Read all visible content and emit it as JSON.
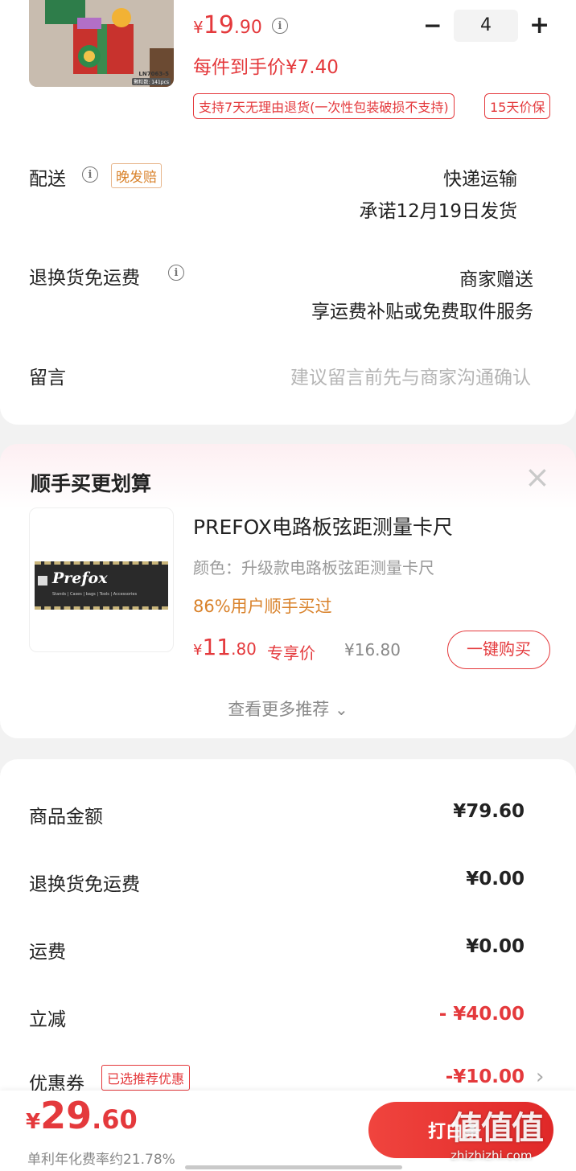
{
  "product": {
    "image_sku": "LN7063-5",
    "image_sub": "颗粒数: 141pcs",
    "price_symbol": "¥",
    "price_int": "19",
    "price_dec": ".90",
    "info_icon": "i",
    "minus": "−",
    "quantity": "4",
    "plus": "+",
    "unit_price_text": "每件到手价¥7.40",
    "return_tag": "支持7天无理由退货(一次性包装破损不支持)",
    "price_protect_tag": "15天价保"
  },
  "delivery": {
    "label": "配送",
    "late_tag": "晚发赔",
    "method": "快递运输",
    "ship_promise": "承诺12月19日发货"
  },
  "return_shipping": {
    "label": "退换货免运费",
    "value1": "商家赠送",
    "value2": "享运费补贴或免费取件服务"
  },
  "message": {
    "label": "留言",
    "placeholder": "建议留言前先与商家沟通确认"
  },
  "recommend": {
    "title": "顺手买更划算",
    "close": "×",
    "logo_text": "Prefox",
    "logo_sub": "Stands | Cases | bags | Tools | Accessories",
    "item_title": "PREFOX电路板弦距测量卡尺",
    "item_color": "颜色：升级款电路板弦距测量卡尺",
    "item_social": "86%用户顺手买过",
    "price_symbol": "¥",
    "price_int": "11",
    "price_dec": ".80",
    "exclusive_label": "专享价",
    "orig_price": "¥16.80",
    "buy_button": "一键购买",
    "more": "查看更多推荐",
    "more_chevron": "⌄"
  },
  "summary": {
    "rows": [
      {
        "label": "商品金额",
        "value": "¥79.60"
      },
      {
        "label": "退换货免运费",
        "value": "¥0.00"
      },
      {
        "label": "运费",
        "value": "¥0.00"
      },
      {
        "label": "立减",
        "value": "- ¥40.00"
      },
      {
        "label": "优惠券",
        "value": "-¥10.00"
      }
    ],
    "coupon_tag": "已选推荐优惠",
    "coupon_chevron": "›"
  },
  "bottom": {
    "price_symbol": "¥",
    "price_int": "29",
    "price_dec": ".60",
    "installment": "单利年化费率约21.78%",
    "pay_button": "打白条"
  },
  "watermark": {
    "main": "值值值",
    "sub": "zhizhizhi.com"
  },
  "colors": {
    "accent": "#e4393c",
    "orange": "#d9822b",
    "gray_text": "#999999"
  }
}
